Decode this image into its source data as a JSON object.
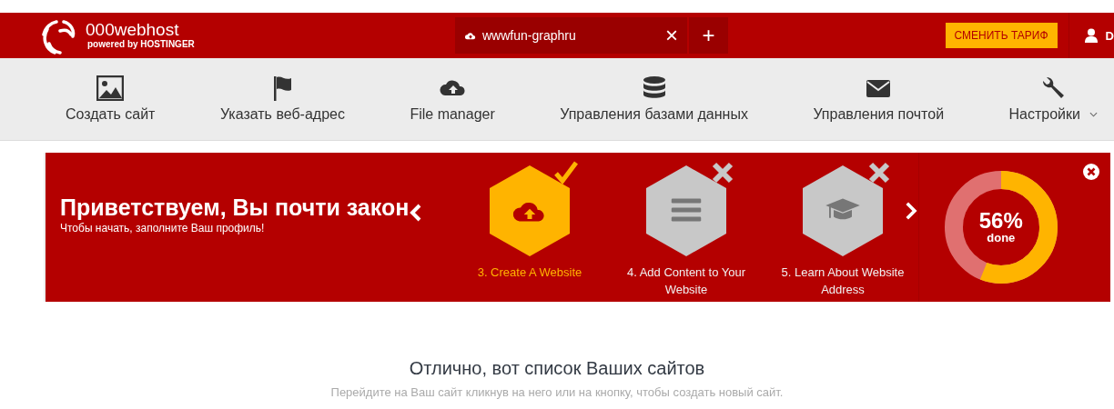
{
  "header": {
    "brand": "000webhost",
    "tagline_prefix": "powered by",
    "tagline_brand": "HOSTINGER",
    "site_tab": {
      "label": "wwwfun-graphru",
      "close": "×",
      "selected": true
    },
    "add_tab": "+",
    "upgrade_button": "СМЕНИТЬ ТАРИФ",
    "user": "D"
  },
  "nav": [
    {
      "label": "Создать сайт",
      "dropdown": false
    },
    {
      "label": "Указать веб-адрес",
      "dropdown": false
    },
    {
      "label": "File manager",
      "dropdown": false
    },
    {
      "label": "Управления базами данных",
      "dropdown": false
    },
    {
      "label": "Управления почтой",
      "dropdown": false
    },
    {
      "label": "Настройки",
      "dropdown": true
    }
  ],
  "banner": {
    "title": "Приветствуем, Вы почти закон",
    "subtitle": "Чтобы начать, заполните Ваш профиль!",
    "steps": [
      {
        "label": "3. Create A Website",
        "done": true
      },
      {
        "label": "4. Add Content to Your Website",
        "done": false
      },
      {
        "label": "5. Learn About Website Address",
        "done": false
      }
    ],
    "progress": {
      "level": 0.56,
      "percent": "56%",
      "caption": "done"
    }
  },
  "content": {
    "heading": "Отлично, вот список Ваших сайтов",
    "subheading": "Перейдите на Ваш сайт кликнув на него или на кнопку, чтобы создать новый сайт."
  }
}
